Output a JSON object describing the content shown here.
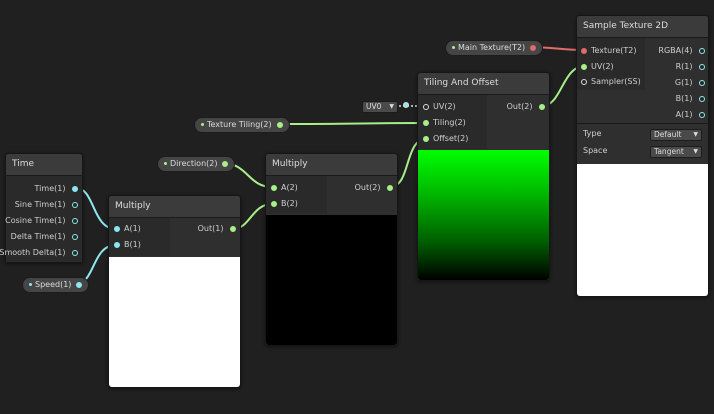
{
  "nodes": {
    "time": {
      "title": "Time",
      "outputs": [
        "Time(1)",
        "Sine Time(1)",
        "Cosine Time(1)",
        "Delta Time(1)",
        "Smooth Delta(1)"
      ]
    },
    "multiply1": {
      "title": "Multiply",
      "inputs": [
        "A(1)",
        "B(1)"
      ],
      "output": "Out(1)"
    },
    "multiply2": {
      "title": "Multiply",
      "inputs": [
        "A(2)",
        "B(2)"
      ],
      "output": "Out(2)"
    },
    "tiling": {
      "title": "Tiling And Offset",
      "inputs": [
        "UV(2)",
        "Tiling(2)",
        "Offset(2)"
      ],
      "output": "Out(2)",
      "uv_dropdown": "UV0"
    },
    "sample": {
      "title": "Sample Texture 2D",
      "inputs": [
        "Texture(T2)",
        "UV(2)",
        "Sampler(SS)"
      ],
      "outputs": [
        "RGBA(4)",
        "R(1)",
        "G(1)",
        "B(1)",
        "A(1)"
      ],
      "settings": [
        {
          "label": "Type",
          "value": "Default"
        },
        {
          "label": "Space",
          "value": "Tangent"
        }
      ]
    }
  },
  "properties": {
    "speed": "Speed(1)",
    "direction": "Direction(2)",
    "texture_tiling": "Texture Tiling(2)",
    "main_texture": "Main Texture(T2)"
  },
  "colors": {
    "vector1": "#8ee6ef",
    "vector2": "#a8ef8a",
    "texture": "#e06b6b",
    "background": "#202020"
  }
}
